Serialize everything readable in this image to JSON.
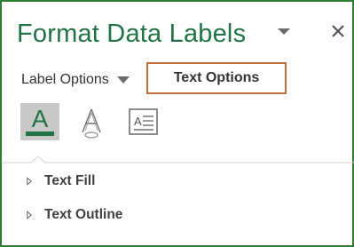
{
  "pane": {
    "title": "Format Data Labels",
    "border_color": "#2e7d32",
    "title_color": "#217346"
  },
  "tabs": {
    "label_options": "Label Options",
    "text_options": "Text Options",
    "active": "text_options",
    "active_outline_color": "#c0703a"
  },
  "icons": [
    {
      "name": "text-fill-outline-icon",
      "selected": true,
      "color": "#217346"
    },
    {
      "name": "text-effects-icon",
      "selected": false
    },
    {
      "name": "textbox-icon",
      "selected": false
    }
  ],
  "sections": {
    "text_fill": "Text Fill",
    "text_outline": "Text Outline"
  }
}
